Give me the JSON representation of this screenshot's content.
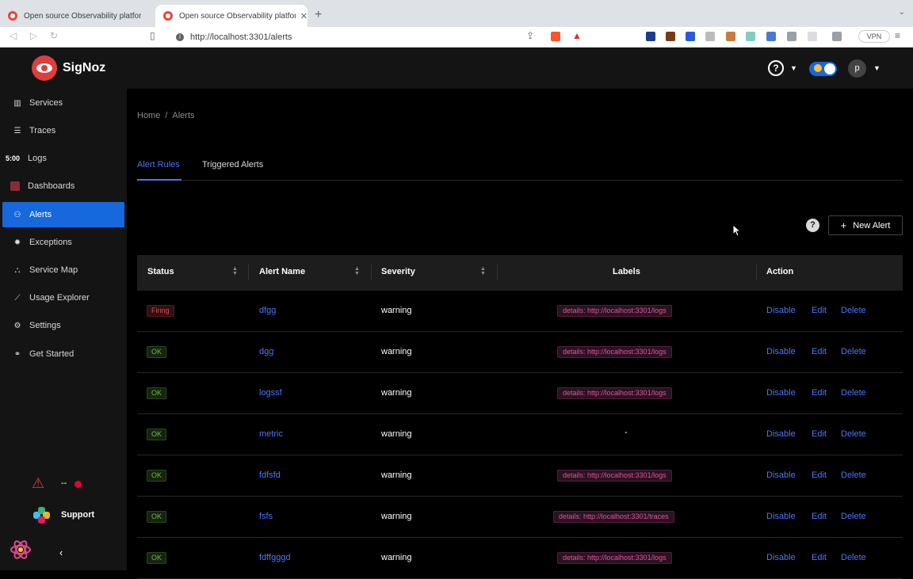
{
  "browser": {
    "tabs": [
      {
        "title": "Open source Observability platform"
      },
      {
        "title": "Open source Observability platform"
      }
    ],
    "url": "http://localhost:3301/alerts",
    "vpn_label": "VPN"
  },
  "app": {
    "brand": "SigNoz",
    "avatar_initial": "p"
  },
  "sidebar": {
    "items": [
      {
        "label": "Services",
        "icon": "bar-chart-icon"
      },
      {
        "label": "Traces",
        "icon": "menu-icon"
      },
      {
        "label": "Logs",
        "icon": "clock-icon"
      },
      {
        "label": "Dashboards",
        "icon": "dashboard-icon"
      },
      {
        "label": "Alerts",
        "icon": "alert-icon",
        "active": true
      },
      {
        "label": "Exceptions",
        "icon": "bug-icon"
      },
      {
        "label": "Service Map",
        "icon": "deployment-icon"
      },
      {
        "label": "Usage Explorer",
        "icon": "line-chart-icon"
      },
      {
        "label": "Settings",
        "icon": "gear-icon"
      },
      {
        "label": "Get Started",
        "icon": "link-icon"
      }
    ],
    "logs_badge": "5:00",
    "warn_text": "--",
    "support_label": "Support"
  },
  "breadcrumb": {
    "home": "Home",
    "sep": "/",
    "current": "Alerts"
  },
  "tabs": {
    "alert_rules": "Alert Rules",
    "triggered": "Triggered Alerts"
  },
  "toolbar": {
    "new_alert": "New Alert"
  },
  "table": {
    "headers": {
      "status": "Status",
      "name": "Alert Name",
      "severity": "Severity",
      "labels": "Labels",
      "action": "Action"
    },
    "actions": {
      "disable": "Disable",
      "edit": "Edit",
      "delete": "Delete"
    },
    "rows": [
      {
        "status": "Firing",
        "name": "dfgg",
        "severity": "warning",
        "label": "details: http://localhost:3301/logs"
      },
      {
        "status": "OK",
        "name": "dgg",
        "severity": "warning",
        "label": "details: http://localhost:3301/logs"
      },
      {
        "status": "OK",
        "name": "logssf",
        "severity": "warning",
        "label": "details: http://localhost:3301/logs"
      },
      {
        "status": "OK",
        "name": "metric",
        "severity": "warning",
        "label": "-"
      },
      {
        "status": "OK",
        "name": "fdfsfd",
        "severity": "warning",
        "label": "details: http://localhost:3301/logs"
      },
      {
        "status": "OK",
        "name": "fsfs",
        "severity": "warning",
        "label": "details: http://localhost:3301/traces"
      },
      {
        "status": "OK",
        "name": "fdffgggd",
        "severity": "warning",
        "label": "details: http://localhost:3301/logs"
      }
    ]
  },
  "colors": {
    "accent": "#1668dc",
    "link": "#4e74f8",
    "brand": "#e13d3d"
  }
}
